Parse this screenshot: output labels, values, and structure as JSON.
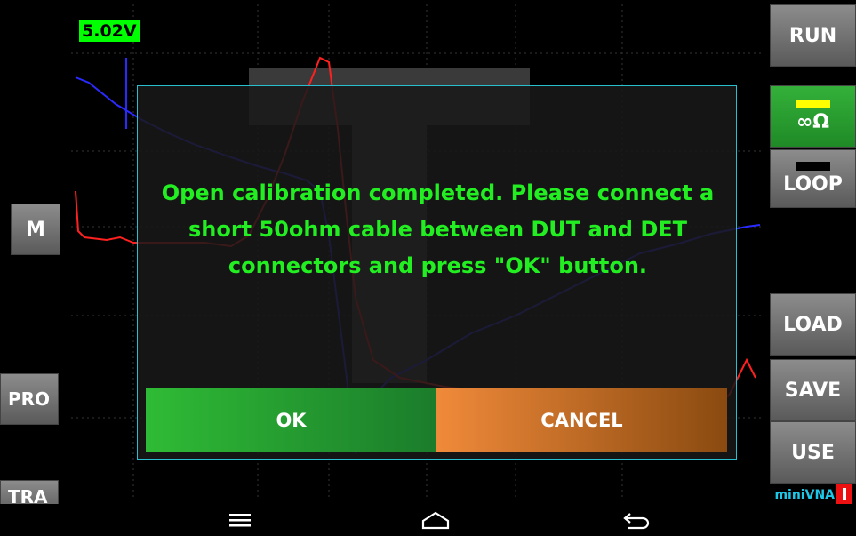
{
  "voltage": "5.02V",
  "right_buttons": {
    "run": "RUN",
    "impedance": "∞Ω",
    "loop": "LOOP",
    "load": "LOAD",
    "save": "SAVE",
    "use": "USE"
  },
  "left_buttons": {
    "m": "M",
    "pro": "PRO",
    "tra": "TRA"
  },
  "brand": "miniVNA",
  "dialog": {
    "message": "Open calibration completed. Please connect a short 50ohm cable between DUT and DET connectors and press \"OK\" button.",
    "ok_label": "OK",
    "cancel_label": "CANCEL"
  },
  "colors": {
    "accent_green": "#22ee22",
    "ok_button": "#2fbb35",
    "cancel_button": "#f08a3a",
    "dialog_border": "#28c0d0",
    "trace_blue": "#2a2aff",
    "trace_red": "#ff2020"
  },
  "navbar": {
    "icons": [
      "menu-icon",
      "home-icon",
      "back-icon"
    ]
  }
}
